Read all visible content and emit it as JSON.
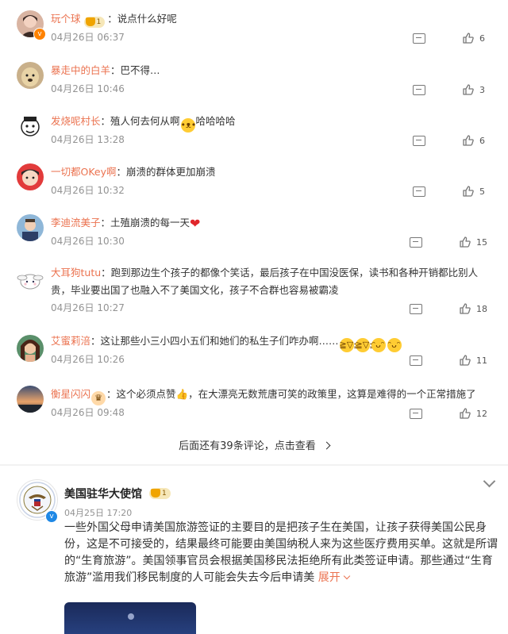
{
  "comments": [
    {
      "user": "玩个球",
      "has_level_badge": true,
      "level": "1",
      "text": "说点什么好呢",
      "time": "04月26日 06:37",
      "likes": "6",
      "verified": "orange"
    },
    {
      "user": "暴走中的白羊",
      "text": "巴不得…",
      "time": "04月26日 10:46",
      "likes": "3"
    },
    {
      "user": "发烧呢村长",
      "text": "殖人何去何从啊",
      "text_after_emoji": "哈哈哈哈",
      "emoji": "doge-emoji",
      "time": "04月26日 13:28",
      "likes": "6"
    },
    {
      "user": "一切都OKey啊",
      "text": "崩溃的群体更加崩溃",
      "time": "04月26日 10:32",
      "likes": "5"
    },
    {
      "user": "李迪流美子",
      "text": "土殖崩溃的每一天",
      "emoji": "red-heart-icon",
      "time": "04月26日 10:30",
      "likes": "15"
    },
    {
      "user": "大耳狗tutu",
      "text": "跑到那边生个孩子的都像个笑话，最后孩子在中国没医保，读书和各种开销都比别人贵，毕业要出国了也融入不了美国文化，孩子不合群也容易被霸凌",
      "time": "04月26日 10:27",
      "likes": "18"
    },
    {
      "user": "艾蜜莉涪",
      "text": "这让那些小三小四小五们和她们的私生子们咋办啊……",
      "emojis": [
        "laugh-cry-emoji",
        "laugh-cry-emoji",
        "yummy-emoji",
        "yummy-emoji"
      ],
      "time": "04月26日 10:26",
      "likes": "11"
    },
    {
      "user": "衡星闪闪",
      "has_fan_badge": true,
      "text": "这个必须点赞",
      "text_after_emoji": "，在大漂亮无数荒唐可笑的政策里，这算是难得的一个正常措施了",
      "emoji": "thumbs-up-emoji",
      "time": "04月26日 09:48",
      "likes": "12"
    }
  ],
  "more_comments": "后面还有39条评论，点击查看",
  "post": {
    "author": "美国驻华大使馆",
    "level": "1",
    "time": "04月25日 17:20",
    "text": "一些外国父母申请美国旅游签证的主要目的是把孩子生在美国，让孩子获得美国公民身份，这是不可接受的，结果最终可能要由美国纳税人来为这些医疗费用买单。这就是所谓的“生育旅游”。美国领事官员会根据美国移民法拒绝所有此类签证申请。那些通过“生育旅游”滥用我们移民制度的人可能会失去今后申请美",
    "expand_label": "展开",
    "verified": "blue"
  },
  "colors": {
    "username": "#eb7350",
    "meta": "#939393",
    "text": "#333333",
    "level_badge": "#f6e7b8",
    "verified_blue": "#1e88e5",
    "verified_orange": "#ff8200"
  }
}
